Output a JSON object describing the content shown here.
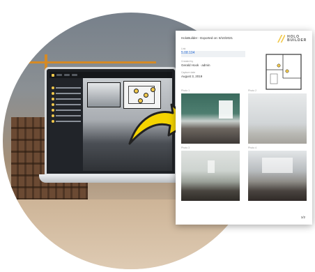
{
  "report": {
    "header_text": "HoloBuilder - Exported on: 8/10/2021",
    "logo_line1": "HOLO",
    "logo_line2": "BUILDER",
    "fields": [
      {
        "label": "Link",
        "value": "5.08.104",
        "is_link": true
      },
      {
        "label": "Created by",
        "value": "Gerald Hook · admin",
        "is_link": false
      },
      {
        "label": "Capture date",
        "value": "August 3, 2019",
        "is_link": false
      }
    ],
    "photo_captions": [
      "Photo 1",
      "Photo 2",
      "Photo 3",
      "Photo 4"
    ],
    "page_number": "1/2"
  },
  "colors": {
    "accent_yellow": "#f2c94c",
    "link_blue": "#2d6fd6",
    "arrow_yellow": "#f5d400"
  },
  "icons": {
    "arrow": "curved-arrow-icon",
    "logo": "holobuilder-logo-icon",
    "pin": "map-pin-icon"
  }
}
